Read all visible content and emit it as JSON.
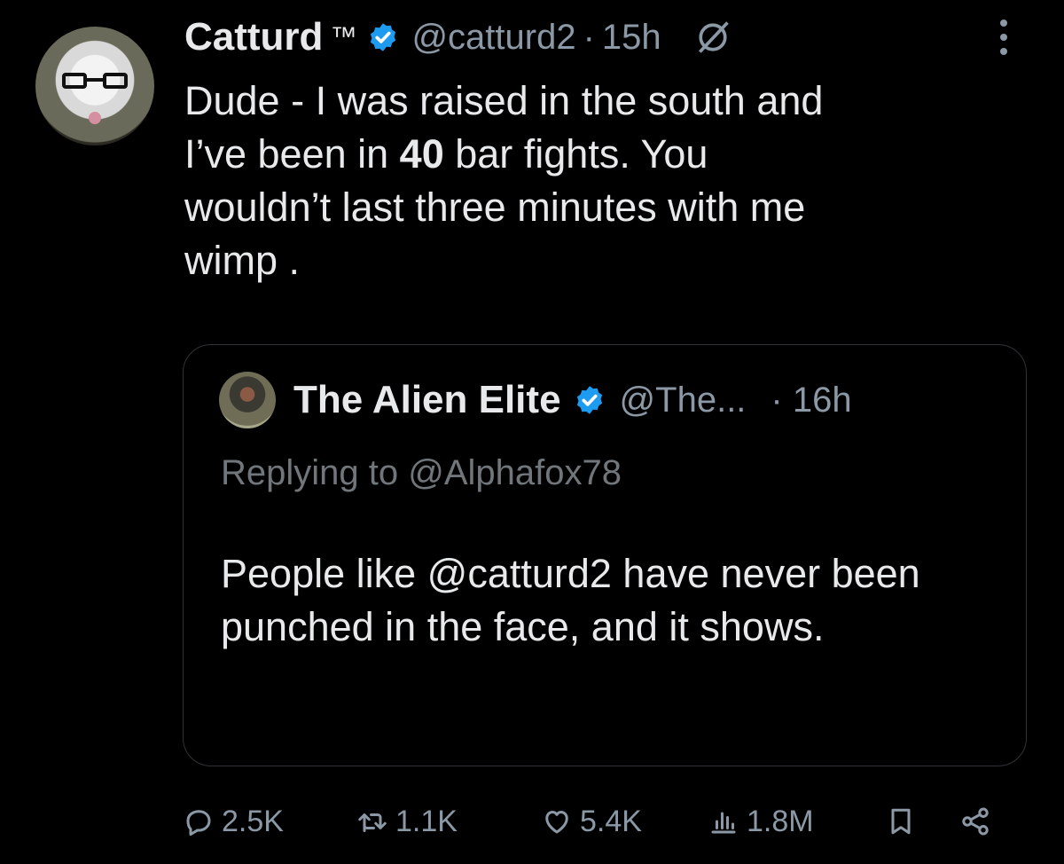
{
  "tweet": {
    "author_name": "Catturd",
    "trademark": "™",
    "handle": "@catturd2",
    "separator": "·",
    "time": "15h",
    "text_before": "Dude - I was raised in the south and\nI’ve been in ",
    "text_bold": "40",
    "text_after": " bar fights. You\nwouldn’t last three minutes with me\nwimp ."
  },
  "quote": {
    "author_name": "The Alien Elite",
    "handle": "@The...",
    "time": "· 16h",
    "replying_to": "Replying to @Alphafox78",
    "text": "People like @catturd2 have never been punched in the face, and it shows."
  },
  "actions": {
    "replies": "2.5K",
    "retweets": "1.1K",
    "likes": "5.4K",
    "views": "1.8M"
  },
  "icons": {
    "verified": "verified-badge-icon",
    "grok": "grok-icon",
    "more": "more-dots-icon",
    "reply": "reply-icon",
    "retweet": "retweet-icon",
    "like": "heart-icon",
    "views": "views-icon",
    "bookmark": "bookmark-icon",
    "share": "share-icon"
  },
  "colors": {
    "background": "#000000",
    "text": "#e7e9ea",
    "secondary": "#8b98a5",
    "verified": "#1d9bf0",
    "border": "#2f3336"
  }
}
